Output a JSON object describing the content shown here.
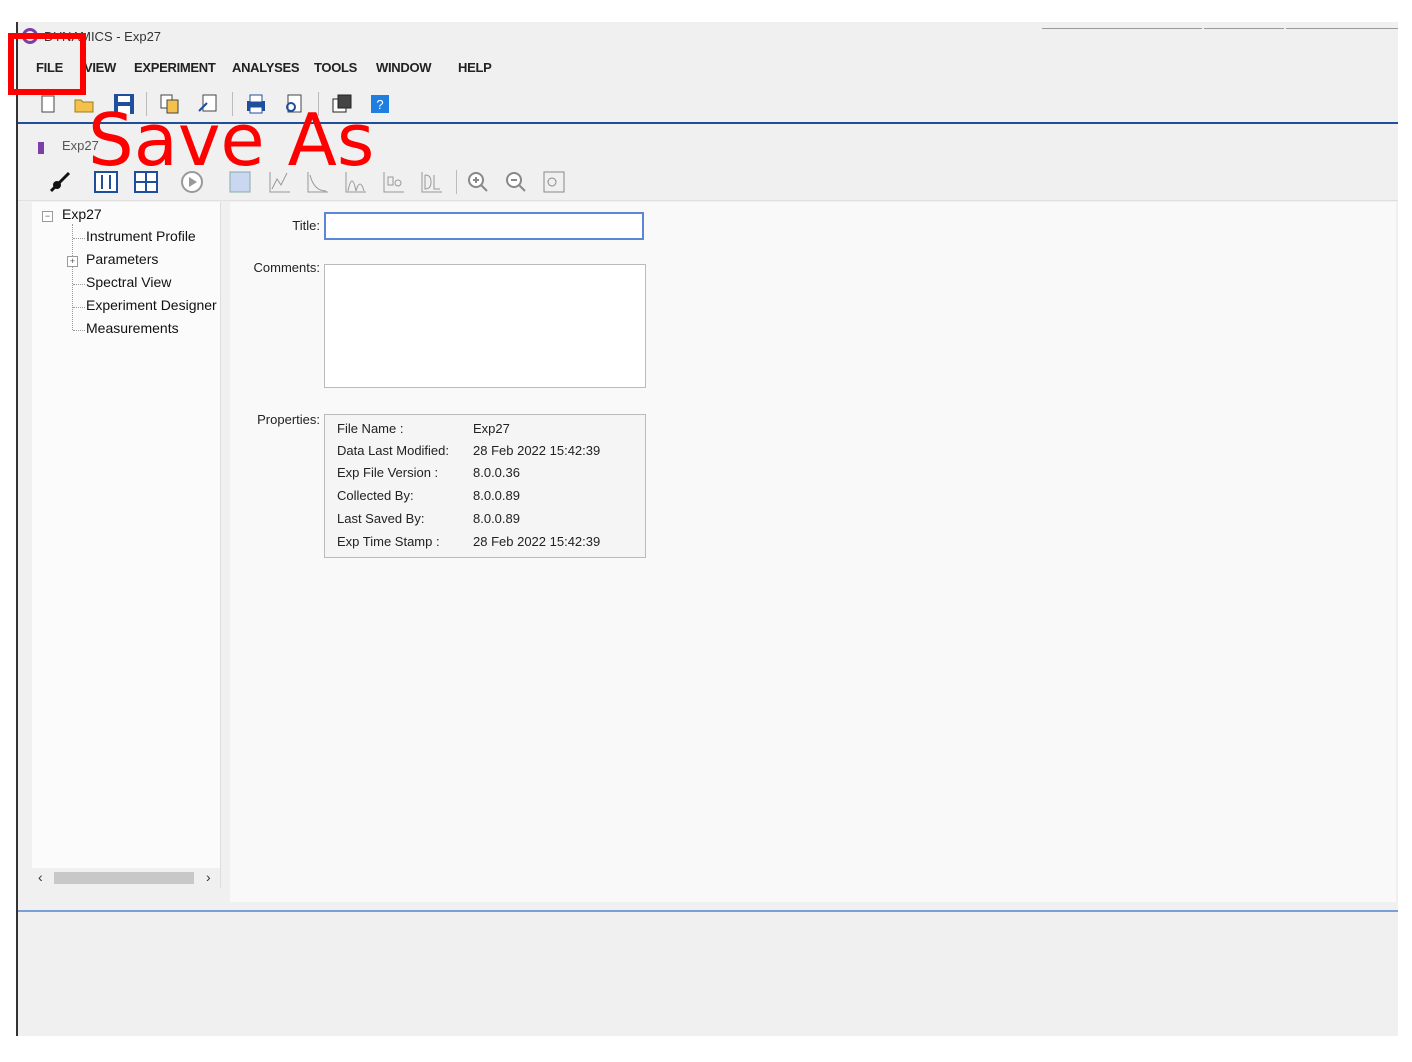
{
  "window": {
    "title": "DYNAMICS - Exp27"
  },
  "menu": [
    "FILE",
    "VIEW",
    "EXPERIMENT",
    "ANALYSES",
    "TOOLS",
    "WINDOW",
    "HELP"
  ],
  "toolbar": {
    "icons": [
      "new-icon",
      "open-icon",
      "save-icon",
      "copy-icon",
      "export-icon",
      "print-icon",
      "print-preview-icon",
      "window-icon",
      "help-icon"
    ]
  },
  "document": {
    "tab_title": "Exp27",
    "toolbar_icons": [
      "connect-icon",
      "parameters-icon",
      "grid-icon",
      "play-icon",
      "chart-icon",
      "line-chart-icon",
      "curve-icon",
      "peaks-icon",
      "distribution-icon",
      "dl-icon",
      "zoom-in-icon",
      "zoom-out-icon",
      "zoom-fit-icon"
    ]
  },
  "tree": {
    "root": "Exp27",
    "items": [
      "Instrument Profile",
      "Parameters",
      "Spectral View",
      "Experiment Designer",
      "Measurements"
    ]
  },
  "form": {
    "title_label": "Title:",
    "title_value": "",
    "comments_label": "Comments:",
    "properties_label": "Properties:"
  },
  "properties": [
    {
      "name": "File Name :",
      "value": "Exp27"
    },
    {
      "name": "Data Last Modified:",
      "value": "28 Feb 2022 15:42:39"
    },
    {
      "name": "Exp File Version :",
      "value": "8.0.0.36"
    },
    {
      "name": "Collected By:",
      "value": "8.0.0.89"
    },
    {
      "name": "Last Saved By:",
      "value": "8.0.0.89"
    },
    {
      "name": "Exp Time Stamp :",
      "value": "28 Feb 2022 15:42:39"
    }
  ],
  "annotation": {
    "text": "Save As",
    "color": "#ff0000"
  }
}
